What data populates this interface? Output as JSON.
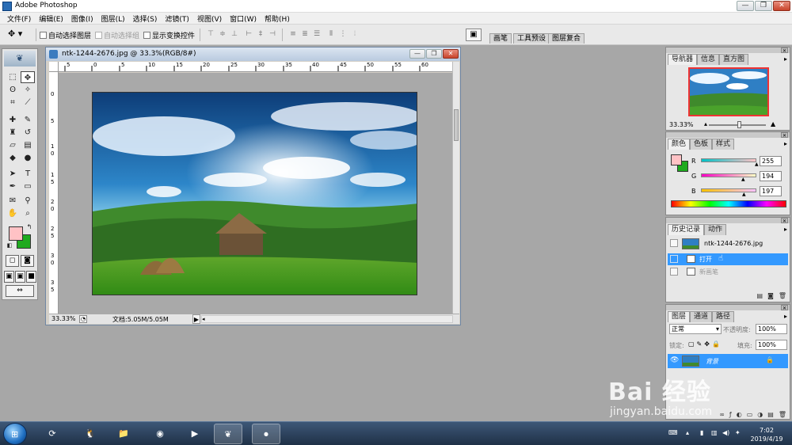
{
  "app": {
    "title": "Adobe Photoshop"
  },
  "window_controls": {
    "minimize": "—",
    "restore": "❐",
    "close": "✕"
  },
  "menu": [
    "文件(F)",
    "编辑(E)",
    "图像(I)",
    "图层(L)",
    "选择(S)",
    "滤镜(T)",
    "视图(V)",
    "窗口(W)",
    "帮助(H)"
  ],
  "options": {
    "auto_select_layer": "自动选择图层",
    "auto_select_group": "自动选择组",
    "show_transform": "显示变换控件",
    "palette_well_tabs": [
      "画笔",
      "工具预设",
      "图层复合"
    ]
  },
  "document": {
    "title": "ntk-1244-2676.jpg @ 33.3%(RGB/8#)",
    "zoom": "33.33%",
    "doc_info": "文档:5.05M/5.05M",
    "ruler_top": [
      "5",
      "0",
      "5",
      "10",
      "15",
      "20",
      "25",
      "30",
      "35",
      "40",
      "45",
      "50",
      "55",
      "60"
    ],
    "ruler_left": [
      "0",
      "5",
      "1",
      "0",
      "1",
      "5",
      "2",
      "0",
      "2",
      "5",
      "3",
      "0",
      "3",
      "5"
    ]
  },
  "panels": {
    "navigator": {
      "tabs": [
        "导航器",
        "信息",
        "直方图"
      ],
      "zoom": "33.33%"
    },
    "color": {
      "tabs": [
        "颜色",
        "色板",
        "样式"
      ],
      "r_label": "R",
      "g_label": "G",
      "b_label": "B",
      "r": "255",
      "g": "194",
      "b": "197"
    },
    "history": {
      "tabs": [
        "历史记录",
        "动作"
      ],
      "snapshot": "ntk-1244-2676.jpg",
      "items": [
        "打开",
        "新画笔"
      ]
    },
    "layers": {
      "tabs": [
        "图层",
        "通道",
        "路径"
      ],
      "blend_mode": "正常",
      "opacity_label": "不透明度:",
      "opacity": "100%",
      "lock_label": "锁定:",
      "fill_label": "填充:",
      "fill": "100%",
      "layer_name": "背景"
    }
  },
  "taskbar": {
    "start_icon": "windows-logo",
    "time": "7:02",
    "date": "2019/4/19"
  },
  "watermark": {
    "brand": "Bai 经验",
    "url": "jingyan.baidu.com"
  },
  "colors": {
    "foreground": "#ffc2c5",
    "background": "#1faa1f",
    "selection": "#3399ff"
  }
}
